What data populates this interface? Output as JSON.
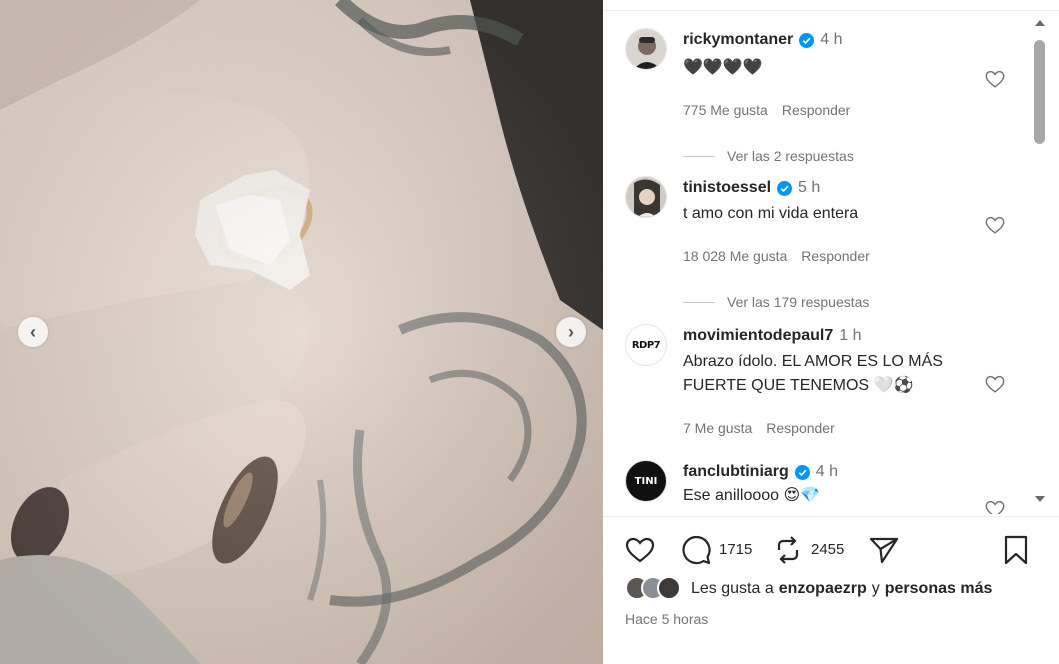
{
  "carousel": {
    "prev_glyph": "‹",
    "next_glyph": "›"
  },
  "comments": [
    {
      "username": "rickymontaner",
      "verified": true,
      "time": "4 h",
      "text": "🖤🖤🖤🖤",
      "likes": "775 Me gusta",
      "reply": "Responder",
      "view_replies": "Ver las 2 respuestas"
    },
    {
      "username": "tinistoessel",
      "verified": true,
      "time": "5 h",
      "text": "t amo con mi vida entera",
      "likes": "18 028 Me gusta",
      "reply": "Responder",
      "view_replies": "Ver las 179 respuestas"
    },
    {
      "username": "movimientodepaul7",
      "verified": false,
      "time": "1 h",
      "text": "Abrazo ídolo. EL AMOR ES LO MÁS FUERTE QUE TENEMOS 🤍⚽",
      "likes": "7 Me gusta",
      "reply": "Responder",
      "avatar_text": "RDP7"
    },
    {
      "username": "fanclubtiniarg",
      "verified": true,
      "time": "4 h",
      "text": "Ese anilloooo 😍💎",
      "avatar_text": "TINI"
    }
  ],
  "actions": {
    "comments_count": "1715",
    "reposts_count": "2455"
  },
  "liked_by": {
    "prefix": "Les gusta a",
    "user": "enzopaezrp",
    "conj": "y",
    "rest": "personas más"
  },
  "posted": "Hace 5 horas",
  "icons": [
    "heart-icon",
    "comment-icon",
    "repost-icon",
    "share-icon",
    "bookmark-icon",
    "verified-icon",
    "chevron-left-icon",
    "chevron-right-icon"
  ],
  "colors": {
    "verified": "#0095f6",
    "text": "#262626",
    "muted": "#737373"
  }
}
